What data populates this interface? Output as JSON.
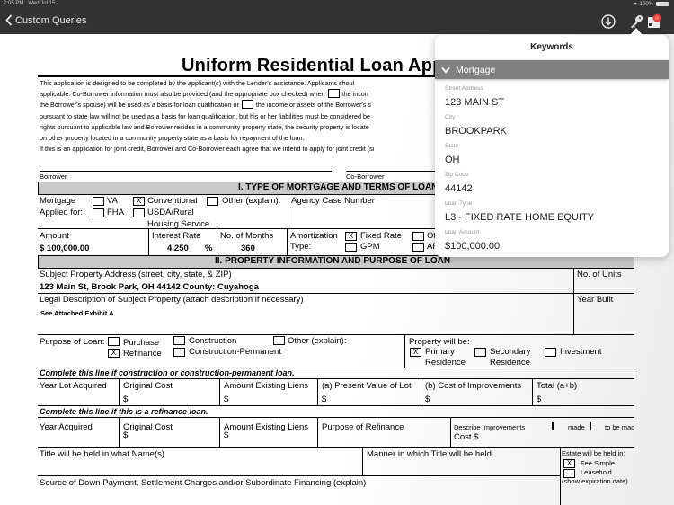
{
  "status_bar": {
    "time": "2:05 PM",
    "date": "Wed Jul 15",
    "battery": "100%"
  },
  "nav": {
    "back_label": "Custom Queries",
    "icons": [
      "download-icon",
      "key-icon",
      "flag-icon"
    ]
  },
  "keywords_popover": {
    "title": "Keywords",
    "group": "Mortgage",
    "fields": [
      {
        "label": "Street Address",
        "value": "123 MAIN ST"
      },
      {
        "label": "City",
        "value": "BROOKPARK"
      },
      {
        "label": "State",
        "value": "OH"
      },
      {
        "label": "Zip Code",
        "value": "44142"
      },
      {
        "label": "Loan Type",
        "value": "L3 - FIXED RATE HOME EQUITY"
      },
      {
        "label": "Loan Amount",
        "value": "$100,000.00"
      }
    ]
  },
  "document": {
    "title": "Uniform Residential Loan Appl",
    "intro_lines": [
      "This application is designed to be completed by the applicant(s) with the Lender's assistance. Applicants shoul",
      "applicable. Co-Borrower information must also be provided (and the appropriate box checked) when",
      "the incon",
      "the Borrower's spouse) will be used as a basis for loan qualification  or",
      "the income or assets of the Borrower's s",
      "pursuant to state law will not be used as a basis for loan qualification, but his or her liabilities must be considered be",
      "rights pursuant to applicable law and Borrower resides in a community property state, the security property is locate",
      "on other property located in a community property state as a basis for repayment of the loan.",
      "If this is an application for joint credit, Borrower and Co-Borrower each agree that we intend to apply for joint credit (si"
    ],
    "borrower_label": "Borrower",
    "coborrower_label": "Co-Borrower",
    "section1": {
      "header": "I. TYPE OF MORTGAGE AND TERMS OF LOAN",
      "mortgage_label": "Mortgage",
      "applied_for_label": "Applied for:",
      "va": "VA",
      "fha": "FHA",
      "conventional": "Conventional",
      "conventional_checked": "X",
      "usda": "USDA/Rural",
      "housing_service": "Housing Service",
      "other": "Other (explain):",
      "agency_case": "Agency Case Number",
      "amount_label": "Amount",
      "amount_value": "$ 100,000.00",
      "interest_label": "Interest Rate",
      "interest_value": "4.250",
      "percent": "%",
      "months_label": "No. of Months",
      "months_value": "360",
      "amortization_label": "Amortization",
      "type_label": "Type:",
      "fixed_rate": "Fixed Rate",
      "fixed_checked": "X",
      "gpm": "GPM",
      "other_cut": "Ot",
      "arm_cut": "AF"
    },
    "section2": {
      "header": "II. PROPERTY INFORMATION AND PURPOSE OF LOAN",
      "subject_address_label": "Subject Property Address (street, city, state, & ZIP)",
      "subject_address_value": "123 Main St, Brook Park, OH 44142 County: Cuyahoga",
      "units_label": "No. of Units",
      "legal_label": "Legal Description of Subject Property (attach description if necessary)",
      "legal_value": "See Attached Exhibit A",
      "year_built_label": "Year Built",
      "purpose_label": "Purpose of Loan:",
      "purchase": "Purchase",
      "refinance": "Refinance",
      "refinance_checked": "X",
      "construction": "Construction",
      "construction_permanent": "Construction-Permanent",
      "other_explain": "Other (explain):",
      "property_will_be": "Property will be:",
      "primary": "Primary",
      "primary_residence": "Residence",
      "primary_checked": "X",
      "secondary": "Secondary",
      "secondary_residence": "Residence",
      "investment": "Investment",
      "construction_line": "Complete this line if construction or construction-permanent loan.",
      "year_lot": "Year Lot Acquired",
      "original_cost": "Original Cost",
      "amount_liens": "Amount Existing Liens",
      "present_value": "(a) Present Value of Lot",
      "cost_improvements": "(b) Cost of Improvements",
      "total": "Total (a+b)",
      "dollar": "$",
      "refinance_line": "Complete this line if this is a refinance loan.",
      "year_acquired": "Year Acquired",
      "purpose_refinance": "Purpose of Refinance",
      "describe_improvements": "Describe Improvements",
      "made": "made",
      "to_be_made": "to be mac",
      "cost_dollar": "Cost $",
      "title_names": "Title will be held in what Name(s)",
      "manner_title": "Manner in which Title will be held",
      "estate_held": "Estate will be held in:",
      "fee_simple": "Fee Simple",
      "fee_simple_checked": "X",
      "leasehold": "Leasehold",
      "expiration": "(show expiration date)",
      "source_down": "Source of Down Payment, Settlement Charges and/or Subordinate Financing (explain)"
    }
  }
}
